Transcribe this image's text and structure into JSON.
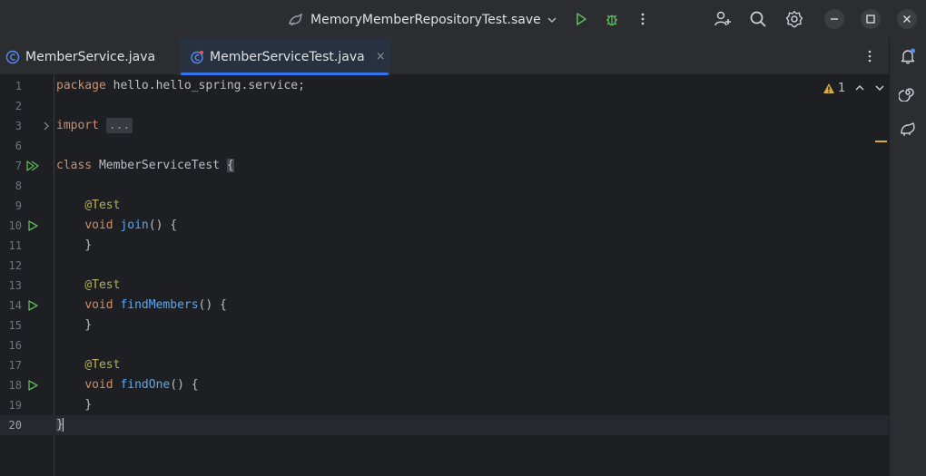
{
  "titlebar": {
    "run_config_name": "MemoryMemberRepositoryTest.save",
    "icons": [
      "run-config-icon",
      "chevron-down-icon",
      "run-icon",
      "debug-icon",
      "more-vertical-icon",
      "add-user-icon",
      "search-icon",
      "settings-icon",
      "minimize-icon",
      "maximize-icon",
      "close-icon"
    ]
  },
  "tabs": [
    {
      "label": "MemberService.java",
      "active": false
    },
    {
      "label": "MemberServiceTest.java",
      "active": true,
      "close": "×"
    }
  ],
  "inspection": {
    "warnings": "1"
  },
  "editor": {
    "lines": [
      {
        "n": "1"
      },
      {
        "n": "2"
      },
      {
        "n": "3"
      },
      {
        "n": "6"
      },
      {
        "n": "7"
      },
      {
        "n": "8"
      },
      {
        "n": "9"
      },
      {
        "n": "10"
      },
      {
        "n": "11"
      },
      {
        "n": "12"
      },
      {
        "n": "13"
      },
      {
        "n": "14"
      },
      {
        "n": "15"
      },
      {
        "n": "16"
      },
      {
        "n": "17"
      },
      {
        "n": "18"
      },
      {
        "n": "19"
      },
      {
        "n": "20"
      }
    ],
    "tokens": {
      "package_kw": "package",
      "package_name": " hello.hello_spring.service;",
      "import_kw": "import",
      "import_fold": "...",
      "class_kw": "class",
      "class_name": " MemberServiceTest ",
      "open_brace": "{",
      "annotation": "@Test",
      "void_kw": "void",
      "m1": "join",
      "m2": "findMembers",
      "m3": "findOne",
      "sig_tail": "() {",
      "close_brace": "}"
    }
  },
  "colors": {
    "background": "#1e1f22",
    "panel": "#2b2d30",
    "keyword": "#cf8e6d",
    "annotation": "#b3ae60",
    "method": "#56a8f5",
    "run_green": "#5fb85f",
    "accent": "#3574f0"
  }
}
